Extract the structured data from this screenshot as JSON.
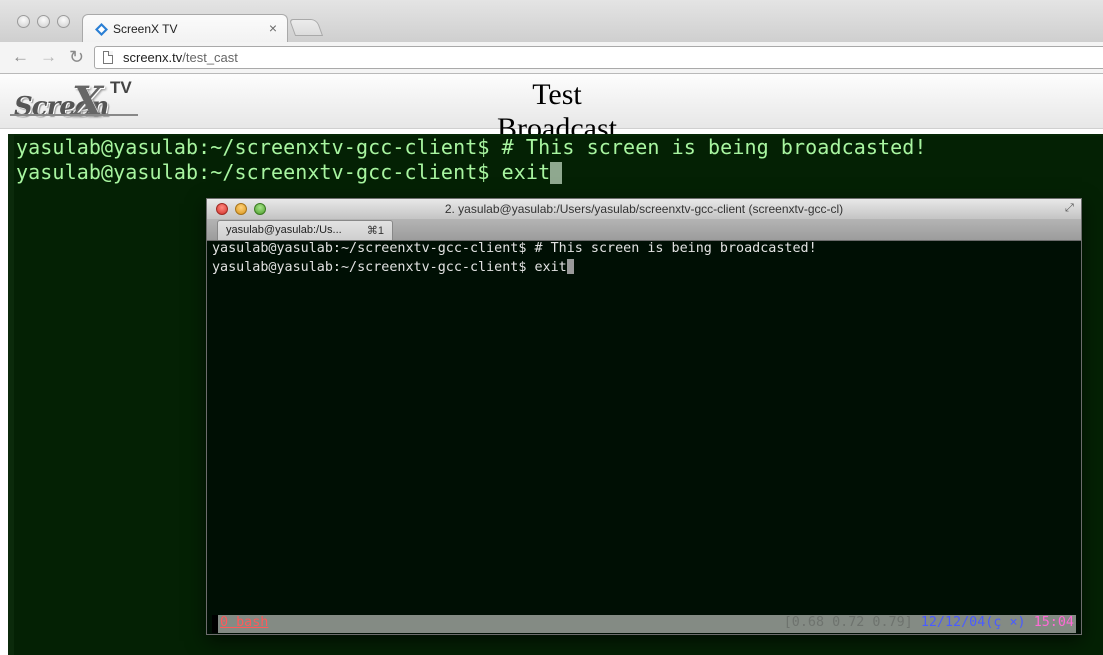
{
  "browser": {
    "tab_title": "ScreenX TV",
    "tab_close": "×",
    "url_host": "screenx.tv",
    "url_path": "/test_cast",
    "nav": {
      "back": "←",
      "forward": "→",
      "reload": "↻"
    }
  },
  "site": {
    "logo_text": "Screen",
    "logo_x": "X",
    "logo_tv": "TV",
    "page_title": "Test Broadcast"
  },
  "broadcast": {
    "lines": [
      "yasulab@yasulab:~/screenxtv-gcc-client$ # This screen is being broadcasted!",
      "yasulab@yasulab:~/screenxtv-gcc-client$ exit"
    ]
  },
  "terminal_window": {
    "title": "2. yasulab@yasulab:/Users/yasulab/screenxtv-gcc-client (screenxtv-gcc-cl)",
    "tab_label": "yasulab@yasulab:/Us...",
    "tab_shortcut": "⌘1",
    "lines": [
      "yasulab@yasulab:~/screenxtv-gcc-client$ # This screen is being broadcasted!",
      "yasulab@yasulab:~/screenxtv-gcc-client$ exit"
    ],
    "status": {
      "window": "0 bash",
      "load": "[0.68 0.72 0.79]",
      "date": "12/12/04(ç ×)",
      "time": "15:04"
    }
  },
  "colors": {
    "terminal_green_text": "#a8f5a0",
    "terminal_bg": "#042104",
    "status_bar": "#848b84"
  }
}
